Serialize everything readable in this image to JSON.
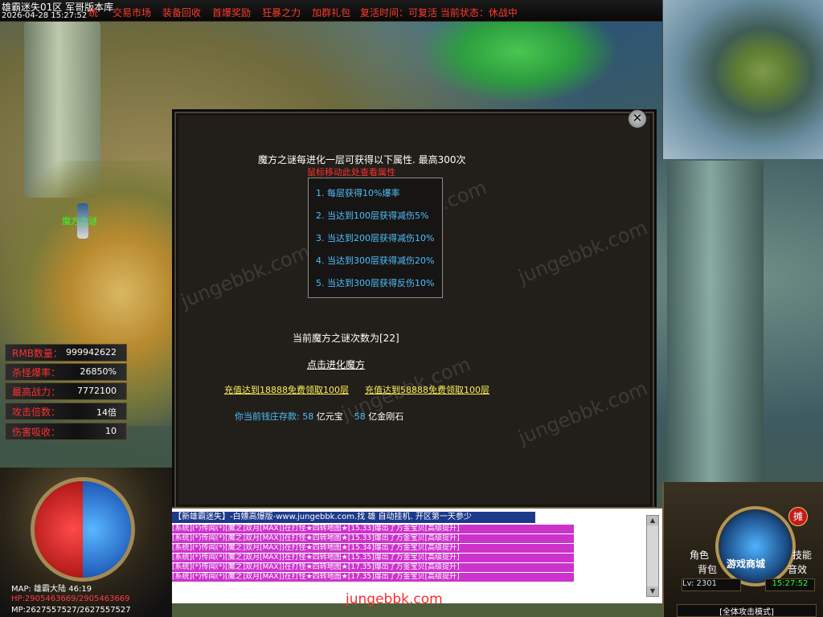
{
  "topbar": {
    "title": "雄霸迷失01区 军哥版本库",
    "datetime": "2026-04-28 15:27:52",
    "menu_partial": "统",
    "menu": [
      "交易市场",
      "装备回收",
      "首爆奖励",
      "狂暴之力",
      "加群礼包"
    ],
    "status": "复活时间：可复活    当前状态：休战中"
  },
  "player": {
    "name": "魔方之谜"
  },
  "stats": [
    {
      "label": "RMB数量：",
      "value": "999942622"
    },
    {
      "label": "杀怪爆率：",
      "value": "26850%"
    },
    {
      "label": "最高战力：",
      "value": "7772100"
    },
    {
      "label": "攻击倍数：",
      "value": "14倍"
    },
    {
      "label": "伤害吸收：",
      "value": "10"
    }
  ],
  "dialog": {
    "close_icon": "✕",
    "description": "魔方之谜每进化一层可获得以下属性. 最高300次",
    "hint": "鼠标移动此处查看属性",
    "attributes": [
      "1. 每层获得10%爆率",
      "2. 当达到100层获得减伤5%",
      "3. 当达到200层获得减伤10%",
      "4. 当达到300层获得减伤20%",
      "5. 当达到300层获得反伤10%"
    ],
    "count_text": "当前魔方之谜次数为[22]",
    "evolve_link": "点击进化魔方",
    "recharge_1": "充值达到18888免费领取100层",
    "recharge_2": "充值达到58888免费领取100层",
    "bank_label": "你当前钱庄存款:",
    "bank_yuanbao_num": "58",
    "bank_yuanbao_unit": "亿元宝",
    "bank_diamond_num": "58",
    "bank_diamond_unit": "亿金刚石"
  },
  "chat": {
    "header": "【新雄霸迷失】-白嫖高爆版-www.jungebbk.com.找 雄 自动挂机. 开区第一天参少",
    "lines": [
      "[系统](*)传闻(*)[魔之]双月[MAX]]在打怪★四转地图★[15.33]爆出了万金宝贝[高级提升]",
      "[系统](*)传闻(*)[魔之]双月[MAX]]在打怪★四转地图★[15.33]爆出了万金宝贝[高级提升]",
      "[系统](*)传闻(*)[魔之]双月[MAX]]在打怪★四转地图★[15.34]爆出了万金宝贝[高级提升]",
      "[系统](*)传闻(*)[魔之]双月[MAX]]在打怪★四转地图★[15.35]爆出了万金宝贝[高级提升]",
      "[系统](*)传闻(*)[魔之]双月[MAX]]在打怪★四转地图★[17.35]爆出了万金宝贝[高级提升]",
      "[系统](*)传闻(*)[魔之]双月[MAX]]在打怪★四转地图★[17.35]爆出了万金宝贝[高级提升]"
    ]
  },
  "watermark": {
    "text": "jungebbk.com",
    "url": "jungebbk.com"
  },
  "hud": {
    "map": "MAP: 雄霸大陆 46:19",
    "hp": "HP:2905463669/2905463669",
    "mp": "MP:2627557527/2627557527",
    "level": "Lv: 2301",
    "clock": "15:27:52",
    "attack_mode": "[全体攻击模式]",
    "stall": "摊",
    "store": "游戏商城",
    "buttons": {
      "role": "角色",
      "bag": "背包",
      "skill": "技能",
      "sound": "音效"
    }
  },
  "colors": {
    "accent_red": "#ff3030",
    "link_blue": "#4cc0ff",
    "recharge_yellow": "#ffee55",
    "chat_magenta": "#cc33cc"
  }
}
